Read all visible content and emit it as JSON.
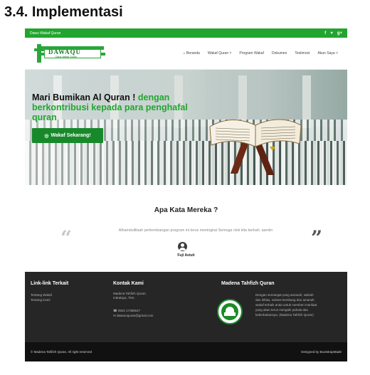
{
  "doc": {
    "heading": "3.4. Implementasi"
  },
  "topbar": {
    "site": "Dawu Wakaf Quran",
    "social": [
      "f",
      "♥",
      "g+"
    ]
  },
  "navbar": {
    "logo": {
      "name": "DAWAQU",
      "sub": "Dana Wakaf Quran"
    },
    "menu": [
      "⌂ Beranda",
      "Wakaf Quran ˅",
      "Program Wakaf",
      "Dokumen",
      "Testimoni",
      "Akun Saya ˅"
    ]
  },
  "hero": {
    "title_black": "Mari Bumikan Al Quran ! ",
    "title_green": "dengan berkontribusi kepada para penghafal quran",
    "cta_icon": "◎",
    "cta": "Wakaf Sekarang!"
  },
  "testimonials": {
    "title": "Apa Kata Mereka ?",
    "quote": "Alhamdulillaah perkembangan program ini terus meningkat Semoga rizki kita berkah. aamiin",
    "author": "Fuji Astuti",
    "open_quote": "“",
    "close_quote": "”"
  },
  "footer": {
    "links_title": "Link-link Terkait",
    "links": [
      "Tentang Wakaf",
      "Tentang Kami"
    ],
    "contact_title": "Kontak Kami",
    "contact_address": [
      "Madena Tahfizh Quran,",
      "Indralaya, Timr."
    ],
    "contact_phone": "☎ 0822 17385547",
    "contact_email": "✉ dawaruquran@gmail.com",
    "about_title": "Madena Tahfizh Quran",
    "about_text": [
      "Dengan semangat yang amanah, sabrah",
      "dan ikhlas, sukses kembang dan amanah",
      "wakaf terbaik anda untuk memberi manfaat",
      "yang akan terus mengalir pahala dan",
      "keberkahannya. (Madena Tahfizh Quran)"
    ],
    "copyright": "© Madena Tahfizh Quran. All right reserved",
    "credit": "Designed by BootstrapMade"
  },
  "colors": {
    "brand_green": "#22a52f",
    "cta_green": "#17892a",
    "footer_bg": "#262626",
    "bottom_bg": "#111111"
  }
}
